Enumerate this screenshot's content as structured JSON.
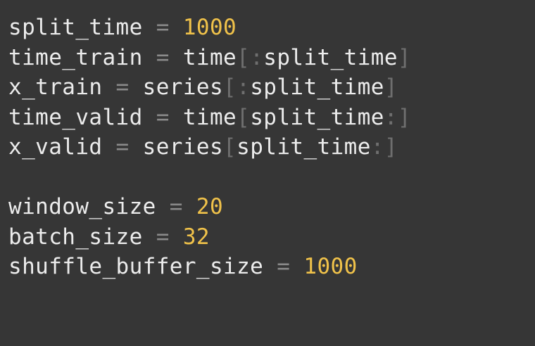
{
  "colors": {
    "background": "#363636",
    "identifier": "#ececec",
    "operator": "#8a8a8a",
    "bracket": "#6f6f6f",
    "number": "#f0c24a"
  },
  "code": {
    "line1": {
      "name": "split_time",
      "op": " = ",
      "value": "1000"
    },
    "line2": {
      "name": "time_train",
      "op": " = ",
      "obj": "time",
      "lb": "[",
      "colon": ":",
      "idx": "split_time",
      "rb": "]"
    },
    "line3": {
      "name": "x_train",
      "op": " = ",
      "obj": "series",
      "lb": "[",
      "colon": ":",
      "idx": "split_time",
      "rb": "]"
    },
    "line4": {
      "name": "time_valid",
      "op": " = ",
      "obj": "time",
      "lb": "[",
      "idx": "split_time",
      "colon": ":",
      "rb": "]"
    },
    "line5": {
      "name": "x_valid",
      "op": " = ",
      "obj": "series",
      "lb": "[",
      "idx": "split_time",
      "colon": ":",
      "rb": "]"
    },
    "line6": {
      "name": "window_size",
      "op": " = ",
      "value": "20"
    },
    "line7": {
      "name": "batch_size",
      "op": " = ",
      "value": "32"
    },
    "line8": {
      "name": "shuffle_buffer_size",
      "op": " = ",
      "value": "1000"
    }
  }
}
